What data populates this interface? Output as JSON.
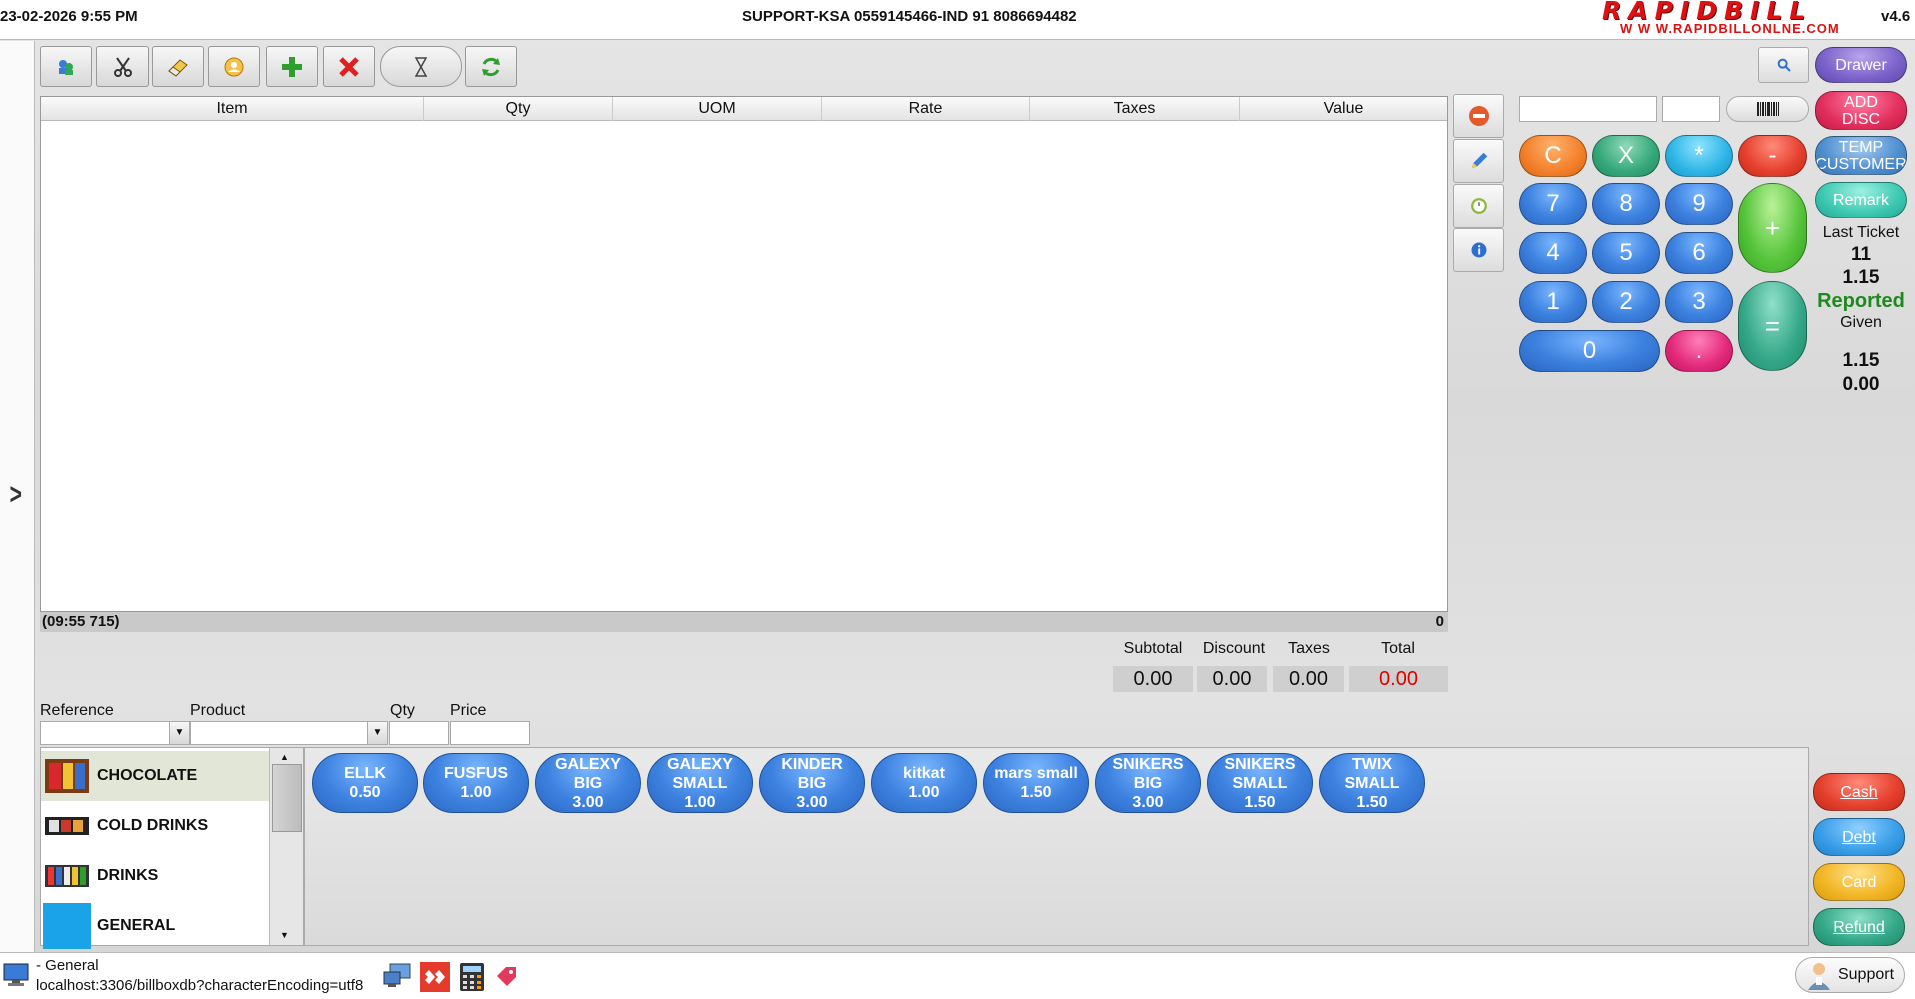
{
  "header": {
    "datetime": "23-02-2026 9:55 PM",
    "support_line": "SUPPORT-KSA 0559145466-IND 91 8086694482",
    "logo": "RAPIDBILL",
    "logo_url": "W W W.RAPIDBILLONLNE.COM",
    "version": "v4.6"
  },
  "table": {
    "columns": [
      "Item",
      "Qty",
      "UOM",
      "Rate",
      "Taxes",
      "Value"
    ],
    "rows": [],
    "ticket_time": "(09:55 715)",
    "line_count": "0"
  },
  "totals": {
    "subtotal_label": "Subtotal",
    "subtotal": "0.00",
    "discount_label": "Discount",
    "discount": "0.00",
    "taxes_label": "Taxes",
    "taxes": "0.00",
    "total_label": "Total",
    "total": "0.00",
    "total_color": "#e00000"
  },
  "entry": {
    "reference_label": "Reference",
    "product_label": "Product",
    "qty_label": "Qty",
    "price_label": "Price"
  },
  "categories": [
    {
      "label": "CHOCOLATE",
      "selected": true
    },
    {
      "label": "COLD DRINKS",
      "selected": false
    },
    {
      "label": "DRINKS",
      "selected": false
    },
    {
      "label": "GENERAL",
      "selected": false
    }
  ],
  "products": [
    {
      "l1": "ELLK",
      "l2": "",
      "price": "0.50"
    },
    {
      "l1": "FUSFUS",
      "l2": "",
      "price": "1.00"
    },
    {
      "l1": "GALEXY",
      "l2": "BIG",
      "price": "3.00"
    },
    {
      "l1": "GALEXY",
      "l2": "SMALL",
      "price": "1.00"
    },
    {
      "l1": "KINDER",
      "l2": "BIG",
      "price": "3.00"
    },
    {
      "l1": "kitkat",
      "l2": "",
      "price": "1.00"
    },
    {
      "l1": "mars small",
      "l2": "",
      "price": "1.50"
    },
    {
      "l1": "SNIKERS",
      "l2": "BIG",
      "price": "3.00"
    },
    {
      "l1": "SNIKERS",
      "l2": "SMALL",
      "price": "1.50"
    },
    {
      "l1": "TWIX",
      "l2": "SMALL",
      "price": "1.50"
    }
  ],
  "keypad": {
    "clear": "C",
    "multiply_x": "X",
    "star": "*",
    "minus": "-",
    "d7": "7",
    "d8": "8",
    "d9": "9",
    "plus": "+",
    "d4": "4",
    "d5": "5",
    "d6": "6",
    "d1": "1",
    "d2": "2",
    "d3": "3",
    "equals": "=",
    "d0": "0",
    "dot": "."
  },
  "right_panel": {
    "drawer": "Drawer",
    "add_disc": "ADD DISC",
    "temp_customer": "TEMP CUSTOMER",
    "remark": "Remark",
    "last_ticket_label": "Last Ticket",
    "last_ticket_no": "11",
    "last_ticket_amount": "1.15",
    "reported": "Reported",
    "given_label": "Given",
    "given_amount": "1.15",
    "change_amount": "0.00",
    "reported_color": "#1e8a1e"
  },
  "payments": {
    "cash": "Cash",
    "debt": "Debt",
    "card": "Card",
    "refund": "Refund"
  },
  "statusbar": {
    "general": "- General",
    "db": "localhost:3306/billboxdb?characterEncoding=utf8",
    "support": "Support"
  }
}
